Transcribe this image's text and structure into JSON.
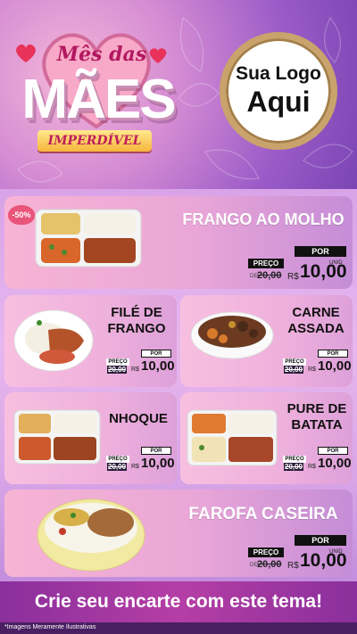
{
  "header": {
    "title_line1": "Mês das",
    "title_line2": "MÃES",
    "title_line3": "IMPERDÍVEL",
    "logo_line1": "Sua Logo",
    "logo_line2": "Aqui"
  },
  "badge": "-50%",
  "products": [
    {
      "name_line1": "FRANGO AO MOLHO",
      "name_line2": "",
      "por_label": "POR",
      "preco_label": "PREÇO",
      "de_label": "DE",
      "old_price": "20,00",
      "currency": "R$",
      "price": "10,00",
      "unit": "UNID"
    },
    {
      "name_line1": "FILÉ DE",
      "name_line2": "FRANGO",
      "por_label": "POR",
      "preco_label": "PREÇO",
      "de_label": "DE",
      "old_price": "20,00",
      "currency": "R$",
      "price": "10,00",
      "unit": "UNID"
    },
    {
      "name_line1": "CARNE",
      "name_line2": "ASSADA",
      "por_label": "POR",
      "preco_label": "PREÇO",
      "de_label": "DE",
      "old_price": "20,00",
      "currency": "R$",
      "price": "10,00",
      "unit": "UNID"
    },
    {
      "name_line1": "NHOQUE",
      "name_line2": "",
      "por_label": "POR",
      "preco_label": "PREÇO",
      "de_label": "DE",
      "old_price": "20,00",
      "currency": "R$",
      "price": "10,00",
      "unit": "UNID"
    },
    {
      "name_line1": "PURE DE",
      "name_line2": "BATATA",
      "por_label": "POR",
      "preco_label": "PREÇO",
      "de_label": "DE",
      "old_price": "20,00",
      "currency": "R$",
      "price": "10,00",
      "unit": "UNID"
    },
    {
      "name_line1": "FAROFA CASEIRA",
      "name_line2": "",
      "por_label": "POR",
      "preco_label": "PREÇO",
      "de_label": "DE",
      "old_price": "20,00",
      "currency": "R$",
      "price": "10,00",
      "unit": "UNID"
    }
  ],
  "cta": "Crie seu encarte com este tema!",
  "footnote": "*Imagens Meramente Ilustrativas",
  "colors": {
    "accent": "#b53ea5",
    "brand_pink": "#c01f5a",
    "price_dark": "#111111"
  }
}
